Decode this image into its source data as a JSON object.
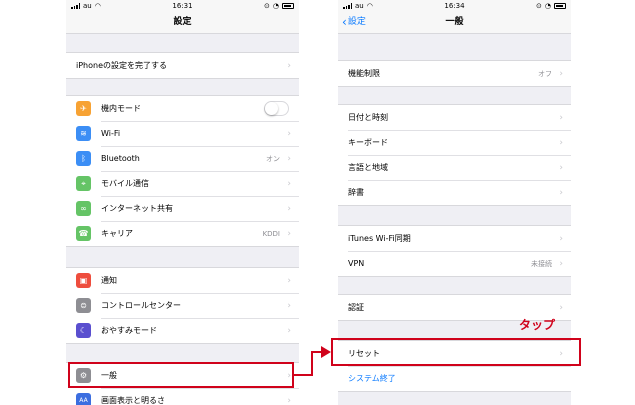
{
  "left_phone": {
    "status": {
      "carrier": "au",
      "time": "16:31"
    },
    "title": "設定",
    "setup_row": {
      "label": "iPhoneの設定を完了する"
    },
    "group1": [
      {
        "label": "機内モード",
        "icon": "airplane-icon",
        "color": "#f7a233",
        "glyph": "✈",
        "toggle": "off"
      },
      {
        "label": "Wi-Fi",
        "icon": "wifi-icon",
        "color": "#3c8ef5",
        "glyph": "≋"
      },
      {
        "label": "Bluetooth",
        "icon": "bluetooth-icon",
        "color": "#3c8ef5",
        "glyph": "ᛒ",
        "value": "オン"
      },
      {
        "label": "モバイル通信",
        "icon": "antenna-icon",
        "color": "#65c466",
        "glyph": "⌖"
      },
      {
        "label": "インターネット共有",
        "icon": "link-icon",
        "color": "#65c466",
        "glyph": "∞"
      },
      {
        "label": "キャリア",
        "icon": "phone-icon",
        "color": "#65c466",
        "glyph": "☎",
        "value": "KDDI"
      }
    ],
    "group2": [
      {
        "label": "通知",
        "icon": "notification-icon",
        "color": "#ee4d3d",
        "glyph": "▣"
      },
      {
        "label": "コントロールセンター",
        "icon": "control-center-icon",
        "color": "#8e8e93",
        "glyph": "⊜"
      },
      {
        "label": "おやすみモード",
        "icon": "moon-icon",
        "color": "#5a4fcf",
        "glyph": "☾"
      }
    ],
    "group3": [
      {
        "label": "一般",
        "icon": "gear-icon",
        "color": "#8e8e93",
        "glyph": "⚙"
      },
      {
        "label": "画面表示と明るさ",
        "icon": "display-icon",
        "color": "#3c6ee0",
        "glyph": "AA"
      }
    ]
  },
  "right_phone": {
    "status": {
      "carrier": "au",
      "time": "16:34"
    },
    "back_label": "設定",
    "title": "一般",
    "group1": [
      {
        "label": "機能制限",
        "value": "オフ"
      }
    ],
    "group2": [
      {
        "label": "日付と時刻"
      },
      {
        "label": "キーボード"
      },
      {
        "label": "言語と地域"
      },
      {
        "label": "辞書"
      }
    ],
    "group3": [
      {
        "label": "iTunes Wi-Fi同期"
      },
      {
        "label": "VPN",
        "value": "未接続"
      }
    ],
    "group4": [
      {
        "label": "認証"
      }
    ],
    "group5": [
      {
        "label": "リセット"
      },
      {
        "label": "システム終了"
      }
    ]
  },
  "annotation": {
    "text": "タップ",
    "color": "#d0021b"
  }
}
